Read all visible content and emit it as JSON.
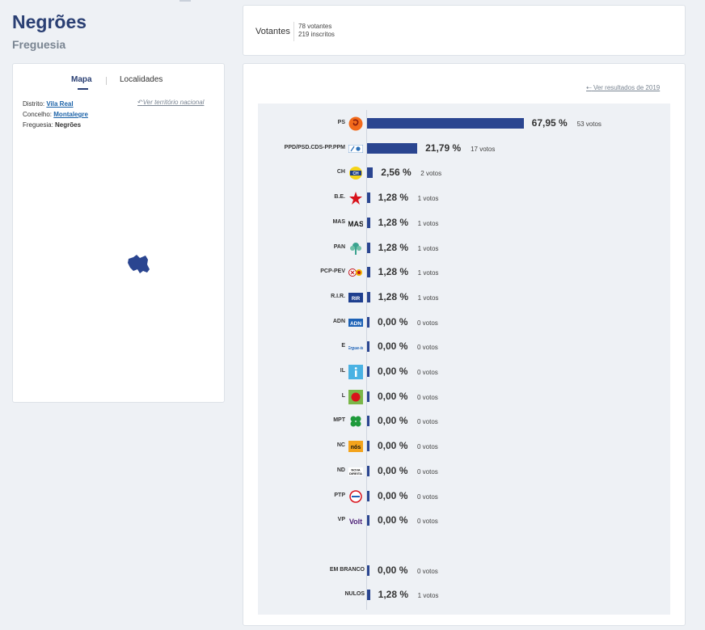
{
  "header": {
    "title": "Negrões",
    "subtitle": "Freguesia"
  },
  "votantes": {
    "label": "Votantes",
    "voters": "78 votantes",
    "registered": "219 inscritos"
  },
  "map_panel": {
    "tabs": [
      {
        "label": "Mapa",
        "active": true
      },
      {
        "label": "Localidades",
        "active": false
      }
    ],
    "distrito_label": "Distrito:",
    "distrito_value": "Vila Real",
    "concelho_label": "Concelho:",
    "concelho_value": "Montalegre",
    "freguesia_label": "Freguesia:",
    "freguesia_value": "Negrões",
    "ver_territorio": "Ver território nacional",
    "map_color": "#2a4590"
  },
  "results": {
    "ver_2019": "Ver resultados de 2019",
    "bar_color": "#2a4590",
    "rows": [
      {
        "party": "PS",
        "pct": "67,95 %",
        "votos": "53 votos",
        "value": 67.95
      },
      {
        "party": "PPD/PSD.CDS-PP.PPM",
        "pct": "21,79 %",
        "votos": "17 votos",
        "value": 21.79
      },
      {
        "party": "CH",
        "pct": "2,56 %",
        "votos": "2 votos",
        "value": 2.56
      },
      {
        "party": "B.E.",
        "pct": "1,28 %",
        "votos": "1 votos",
        "value": 1.28
      },
      {
        "party": "MAS",
        "pct": "1,28 %",
        "votos": "1 votos",
        "value": 1.28
      },
      {
        "party": "PAN",
        "pct": "1,28 %",
        "votos": "1 votos",
        "value": 1.28
      },
      {
        "party": "PCP-PEV",
        "pct": "1,28 %",
        "votos": "1 votos",
        "value": 1.28
      },
      {
        "party": "R.I.R.",
        "pct": "1,28 %",
        "votos": "1 votos",
        "value": 1.28
      },
      {
        "party": "ADN",
        "pct": "0,00 %",
        "votos": "0 votos",
        "value": 0
      },
      {
        "party": "E",
        "pct": "0,00 %",
        "votos": "0 votos",
        "value": 0
      },
      {
        "party": "IL",
        "pct": "0,00 %",
        "votos": "0 votos",
        "value": 0
      },
      {
        "party": "L",
        "pct": "0,00 %",
        "votos": "0 votos",
        "value": 0
      },
      {
        "party": "MPT",
        "pct": "0,00 %",
        "votos": "0 votos",
        "value": 0
      },
      {
        "party": "NC",
        "pct": "0,00 %",
        "votos": "0 votos",
        "value": 0
      },
      {
        "party": "ND",
        "pct": "0,00 %",
        "votos": "0 votos",
        "value": 0
      },
      {
        "party": "PTP",
        "pct": "0,00 %",
        "votos": "0 votos",
        "value": 0
      },
      {
        "party": "VP",
        "pct": "0,00 %",
        "votos": "0 votos",
        "value": 0
      },
      {
        "party": "EM BRANCO",
        "pct": "0,00 %",
        "votos": "0 votos",
        "value": 0
      },
      {
        "party": "NULOS",
        "pct": "1,28 %",
        "votos": "1 votos",
        "value": 1.28
      }
    ]
  },
  "chart_data": {
    "type": "bar",
    "categories": [
      "PS",
      "PPD/PSD.CDS-PP.PPM",
      "CH",
      "B.E.",
      "MAS",
      "PAN",
      "PCP-PEV",
      "R.I.R.",
      "ADN",
      "E",
      "IL",
      "L",
      "MPT",
      "NC",
      "ND",
      "PTP",
      "VP",
      "EM BRANCO",
      "NULOS"
    ],
    "values": [
      67.95,
      21.79,
      2.56,
      1.28,
      1.28,
      1.28,
      1.28,
      1.28,
      0,
      0,
      0,
      0,
      0,
      0,
      0,
      0,
      0,
      0,
      1.28
    ],
    "votes": [
      53,
      17,
      2,
      1,
      1,
      1,
      1,
      1,
      0,
      0,
      0,
      0,
      0,
      0,
      0,
      0,
      0,
      0,
      1
    ],
    "title": "",
    "xlabel": "",
    "ylabel": ""
  }
}
